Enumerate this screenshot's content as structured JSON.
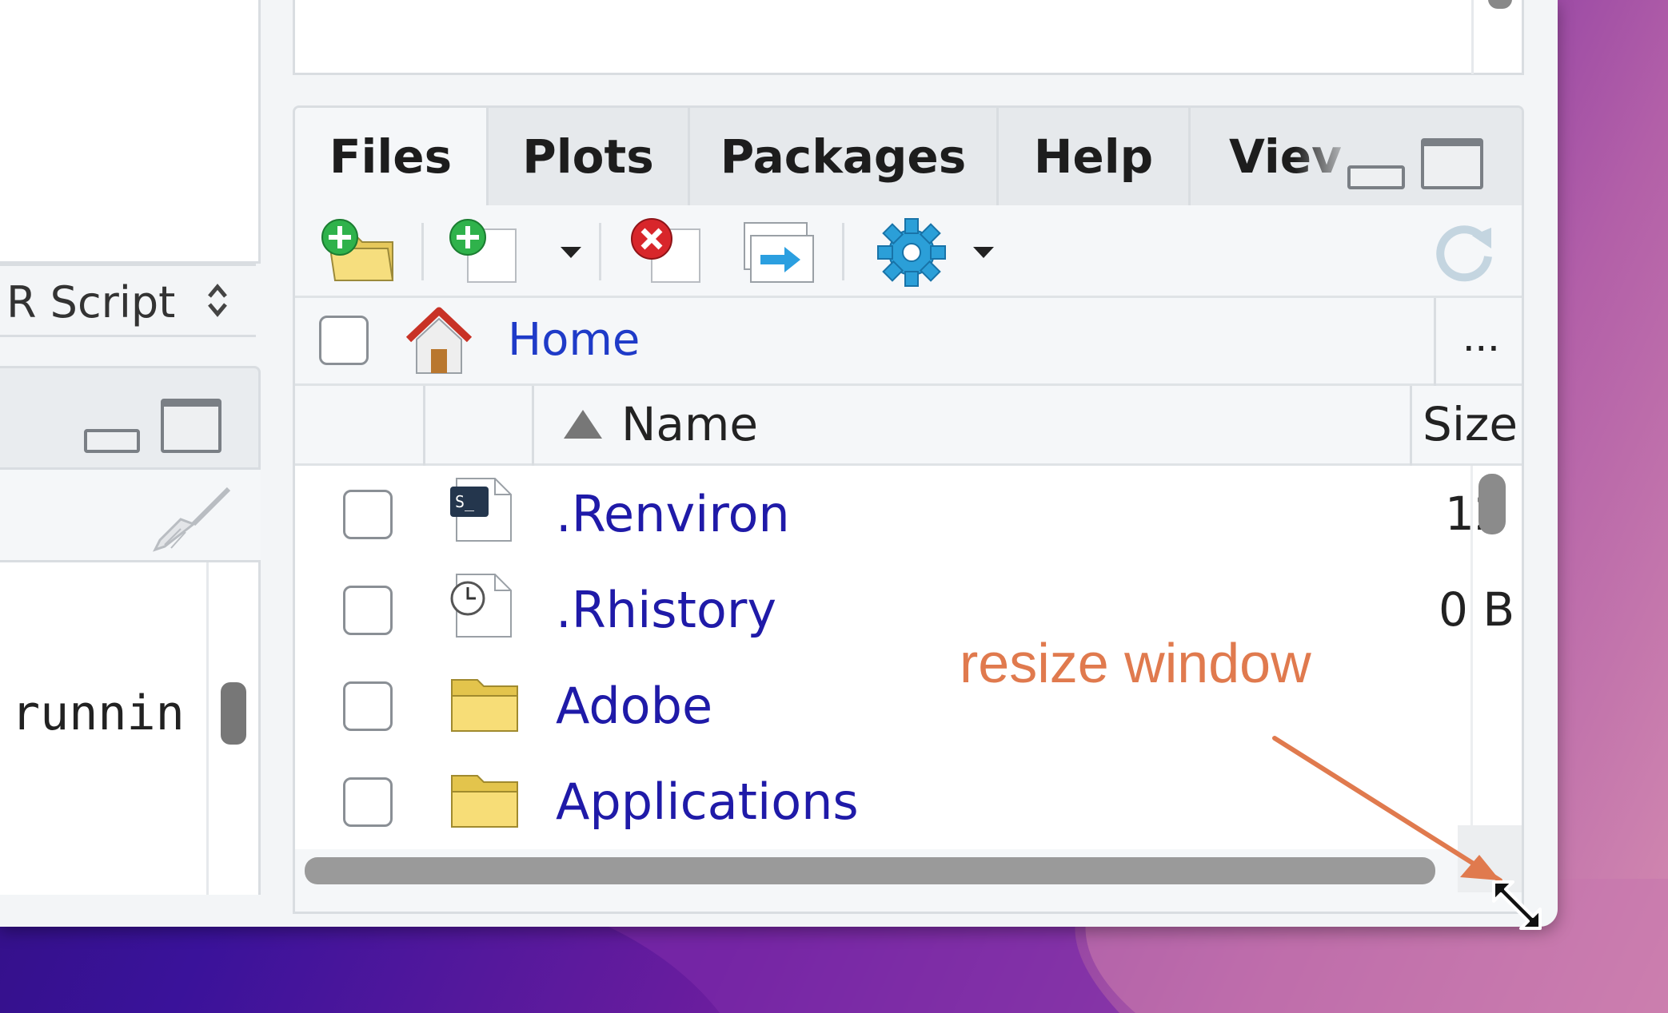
{
  "left_panel": {
    "doc_type_label": "R Script",
    "console_text": "runnin"
  },
  "files_pane": {
    "tabs": [
      {
        "label": "Files",
        "active": true
      },
      {
        "label": "Plots",
        "active": false
      },
      {
        "label": "Packages",
        "active": false
      },
      {
        "label": "Help",
        "active": false
      },
      {
        "label": "Viev",
        "active": false
      }
    ],
    "toolbar": [
      "new-folder-icon",
      "new-file-icon",
      "delete-icon",
      "rename-icon",
      "gear-icon",
      "refresh-icon"
    ],
    "breadcrumb_home": "Home",
    "more_label": "...",
    "column_name": "Name",
    "column_size": "Size",
    "files": [
      {
        "name": ".Renviron",
        "size": "12",
        "icon": "terminal-file-icon"
      },
      {
        "name": ".Rhistory",
        "size": "0 B",
        "icon": "history-file-icon"
      },
      {
        "name": "Adobe",
        "size": "",
        "icon": "folder-icon"
      },
      {
        "name": "Applications",
        "size": "",
        "icon": "folder-icon"
      }
    ]
  },
  "annotation": {
    "text": "resize window",
    "color": "#e07a4e"
  }
}
